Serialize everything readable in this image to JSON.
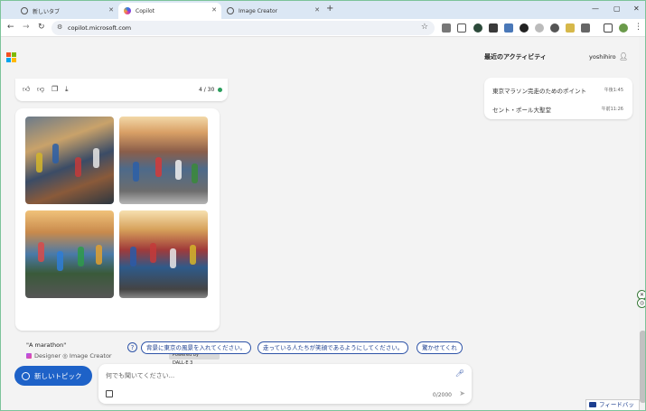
{
  "browser": {
    "tabs": [
      {
        "label": "新しいタブ",
        "active": false
      },
      {
        "label": "Copilot",
        "active": true
      },
      {
        "label": "Image Creator",
        "active": false
      }
    ],
    "new_tab": "+",
    "window_controls": {
      "minimize": "—",
      "maximize": "▢",
      "close": "✕"
    },
    "url": "copilot.microsoft.com",
    "nav": {
      "back": "←",
      "forward": "→",
      "reload": "↻"
    },
    "bookmark_icon": "star-icon",
    "menu": "⋮"
  },
  "feedback_bar": {
    "counter": "4 / 30",
    "counter_color": "#2a9d5c"
  },
  "image_result": {
    "caption": "\"A marathon\"",
    "designer_text": "Designer ◎ Image Creator",
    "powered_by": "Powered by DALL·E 3"
  },
  "suggestions": {
    "items": [
      "背景に東京の風景を入れてください。",
      "走っている人たちが笑顔であるようにしてください。",
      "驚かせてくれ"
    ]
  },
  "composer": {
    "new_topic": "新しいトピック",
    "placeholder": "何でも聞いてください...",
    "char_count": "0/2000"
  },
  "sidebar": {
    "title": "最近のアクティビティ",
    "user": "yoshihiro",
    "items": [
      {
        "label": "東京マラソン完走のためのポイント",
        "time": "午後1:45"
      },
      {
        "label": "セント・ポール大聖堂",
        "time": "午前11:26"
      }
    ]
  },
  "feedback_button": "フィードバック",
  "colors": {
    "accent": "#1e62c8",
    "chip_border": "#2f54a8"
  }
}
